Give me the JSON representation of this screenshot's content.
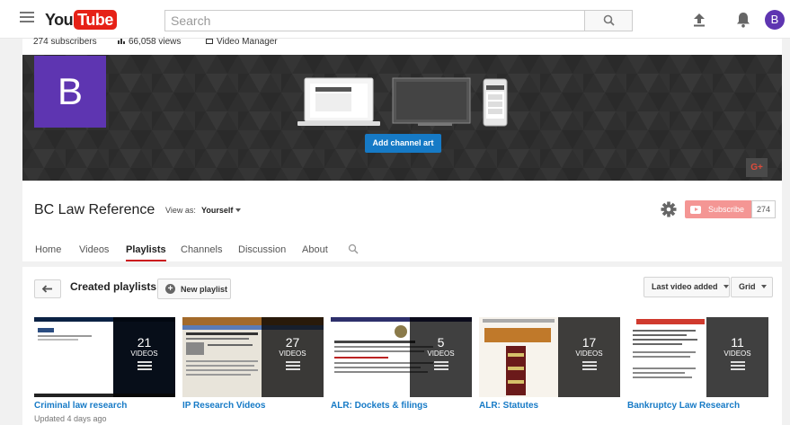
{
  "masthead": {
    "logo_you": "You",
    "logo_tube": "Tube",
    "search_placeholder": "Search",
    "avatar_letter": "B"
  },
  "stats": {
    "subscribers": "274 subscribers",
    "views": "66,058 views",
    "video_manager": "Video Manager"
  },
  "channel": {
    "avatar_letter": "B",
    "add_art_label": "Add channel art",
    "gplus_label": "G+",
    "title": "BC Law Reference",
    "view_as_label": "View as:",
    "view_as_value": "Yourself",
    "subscribe_label": "Subscribe",
    "subscriber_count": "274"
  },
  "tabs": [
    {
      "label": "Home"
    },
    {
      "label": "Videos"
    },
    {
      "label": "Playlists",
      "active": true
    },
    {
      "label": "Channels"
    },
    {
      "label": "Discussion"
    },
    {
      "label": "About"
    }
  ],
  "content": {
    "section_title": "Created playlists",
    "new_playlist_label": "New playlist",
    "sort_label": "Last video added",
    "view_label": "Grid"
  },
  "playlists": [
    {
      "title": "Criminal law research",
      "subtitle": "Updated 4 days ago",
      "count": "21",
      "videos_label": "VIDEOS"
    },
    {
      "title": "IP Research Videos",
      "count": "27",
      "videos_label": "VIDEOS"
    },
    {
      "title": "ALR: Dockets & filings",
      "count": "5",
      "videos_label": "VIDEOS"
    },
    {
      "title": "ALR: Statutes",
      "count": "17",
      "videos_label": "VIDEOS"
    },
    {
      "title": "Bankruptcy Law Research",
      "count": "11",
      "videos_label": "VIDEOS"
    }
  ],
  "colors": {
    "brand_red": "#e62117",
    "avatar_purple": "#5e35b1",
    "link_blue": "#167ac6",
    "subscribe_pink": "#f49694"
  }
}
